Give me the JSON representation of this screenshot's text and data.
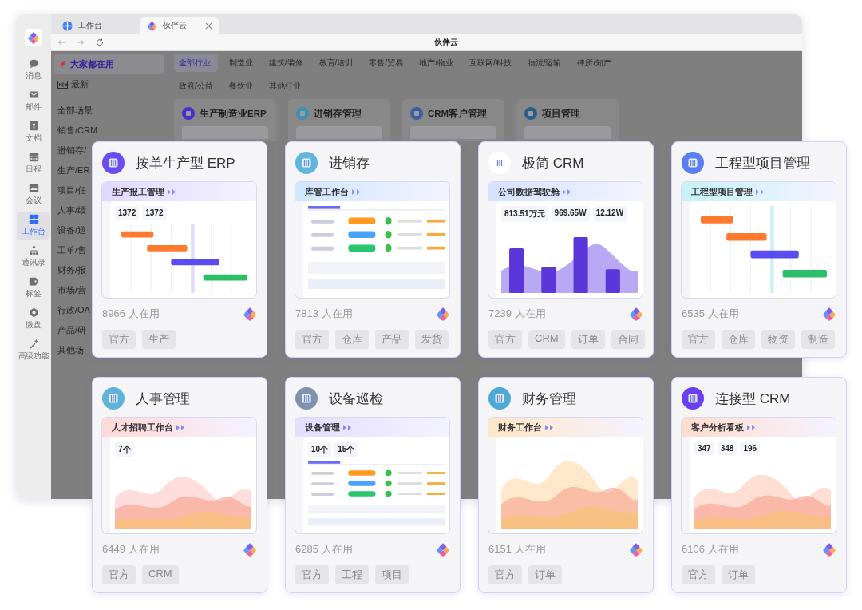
{
  "window": {
    "tabs": [
      {
        "label": "工作台",
        "kind": "workbench",
        "selected": false
      },
      {
        "label": "伙伴云",
        "kind": "logo",
        "selected": true
      }
    ],
    "title": "伙伴云"
  },
  "rail": {
    "items": [
      {
        "label": "消息",
        "kind": "chat",
        "selected": false
      },
      {
        "label": "邮件",
        "kind": "mail",
        "selected": false
      },
      {
        "label": "文档",
        "kind": "doc",
        "selected": false
      },
      {
        "label": "日程",
        "kind": "calendar",
        "selected": false
      },
      {
        "label": "会议",
        "kind": "meeting",
        "selected": false
      },
      {
        "label": "工作台",
        "kind": "grid",
        "selected": true
      },
      {
        "label": "通讯录",
        "kind": "org",
        "selected": false
      },
      {
        "label": "标签",
        "kind": "tag",
        "selected": false
      },
      {
        "label": "微盘",
        "kind": "disk",
        "selected": false
      },
      {
        "label": "高级功能",
        "kind": "magic",
        "selected": false
      }
    ]
  },
  "sidebar": {
    "featured": [
      {
        "label": "大家都在用",
        "kind": "rocket",
        "selected": true
      },
      {
        "label": "最新",
        "kind": "new",
        "selected": false
      }
    ],
    "items": [
      {
        "label": "全部场景",
        "selected": false
      },
      {
        "label": "销售/CRM",
        "selected": false
      },
      {
        "label": "进销存/",
        "selected": false
      },
      {
        "label": "生产/ER",
        "selected": false
      },
      {
        "label": "项目/任",
        "selected": false
      },
      {
        "label": "人事/绩",
        "selected": false
      },
      {
        "label": "设备/巡",
        "selected": false
      },
      {
        "label": "工单/售",
        "selected": false
      },
      {
        "label": "财务/报",
        "selected": false
      },
      {
        "label": "市场/营",
        "selected": false
      },
      {
        "label": "行政/OA",
        "selected": false
      },
      {
        "label": "产品/研",
        "selected": false
      },
      {
        "label": "其他场",
        "selected": false
      }
    ]
  },
  "industry_tabs": [
    {
      "label": "全部行业",
      "selected": true
    },
    {
      "label": "制造业",
      "selected": false
    },
    {
      "label": "建筑/装修",
      "selected": false
    },
    {
      "label": "教育/培训",
      "selected": false
    },
    {
      "label": "零售/贸易",
      "selected": false
    },
    {
      "label": "地产/物业",
      "selected": false
    },
    {
      "label": "互联网/科技",
      "selected": false
    },
    {
      "label": "物流/运输",
      "selected": false
    },
    {
      "label": "律所/知产",
      "selected": false
    },
    {
      "label": "政府/公益",
      "selected": false
    },
    {
      "label": "餐饮业",
      "selected": false
    },
    {
      "label": "其他行业",
      "selected": false
    }
  ],
  "background_cards": [
    {
      "title": "生产制造业ERP",
      "color": "#4b2fc9"
    },
    {
      "title": "进销存管理",
      "color": "#3f8fb0"
    },
    {
      "title": "CRM客户管理",
      "color": "#3a5f9a"
    },
    {
      "title": "项目管理",
      "color": "#2d5b8a"
    }
  ],
  "cards": [
    {
      "title": "按单生产型 ERP",
      "color": "#6a4cf5",
      "preview": {
        "title": "生产报工管理",
        "color": "#e2d8ff",
        "kind": "gantt",
        "figures": [
          "1372",
          "1372"
        ]
      },
      "users": "8966 人在用",
      "tags": [
        "官方",
        "生产"
      ]
    },
    {
      "title": "进销存",
      "color": "#62b6dc",
      "preview": {
        "title": "库管工作台",
        "color": "#cfe6ff",
        "kind": "table"
      },
      "users": "7813 人在用",
      "tags": [
        "官方",
        "仓库",
        "产品",
        "发货"
      ]
    },
    {
      "title": "极简 CRM",
      "color": "#ffffff",
      "preview": {
        "title": "公司数据驾驶舱",
        "color": "#d4e2ff",
        "kind": "bars",
        "figures": [
          "813.51万元",
          "969.65W",
          "12.12W"
        ]
      },
      "users": "7239 人在用",
      "tags": [
        "官方",
        "CRM",
        "订单",
        "合同"
      ]
    },
    {
      "title": "工程型项目管理",
      "color": "#5a7df0",
      "preview": {
        "title": "工程型项目管理",
        "color": "#c6f1f6",
        "kind": "gantt"
      },
      "users": "6535 人在用",
      "tags": [
        "官方",
        "仓库",
        "物资",
        "制造"
      ]
    },
    {
      "title": "人事管理",
      "color": "#5fb3d9",
      "preview": {
        "title": "人才招聘工作台",
        "color": "#ffd9d9",
        "kind": "area",
        "figures": [
          "7个"
        ]
      },
      "users": "6449 人在用",
      "tags": [
        "官方",
        "CRM"
      ]
    },
    {
      "title": "设备巡检",
      "color": "#7f93ad",
      "preview": {
        "title": "设备管理",
        "color": "#e3ddff",
        "kind": "table",
        "figures": [
          "10个",
          "15个"
        ]
      },
      "users": "6285 人在用",
      "tags": [
        "官方",
        "工程",
        "项目"
      ]
    },
    {
      "title": "财务管理",
      "color": "#4fa9d6",
      "preview": {
        "title": "财务工作台",
        "color": "#ffe6c7",
        "kind": "area"
      },
      "users": "6151 人在用",
      "tags": [
        "官方",
        "订单"
      ]
    },
    {
      "title": "连接型 CRM",
      "color": "#6a3ff0",
      "preview": {
        "title": "客户分析看板",
        "color": "#ffdccf",
        "kind": "area",
        "figures": [
          "347",
          "348",
          "196"
        ]
      },
      "users": "6106 人在用",
      "tags": [
        "官方",
        "订单"
      ]
    }
  ]
}
